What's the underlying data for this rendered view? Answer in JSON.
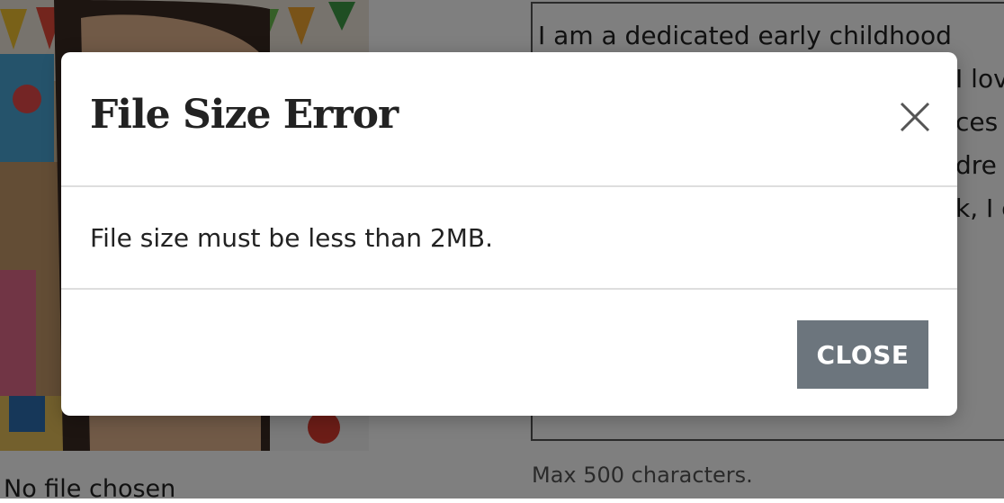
{
  "background": {
    "file_status": "No file chosen",
    "bio_lines": [
      "I am a dedicated early childhood",
      "I lov",
      "ces",
      "dre",
      "k, I e"
    ],
    "max_note": "Max 500 characters."
  },
  "modal": {
    "title": "File Size Error",
    "message": "File size must be less than 2MB.",
    "close_button_label": "CLOSE",
    "close_icon": "close-x-icon"
  },
  "colors": {
    "button_bg": "#6c757d",
    "overlay": "rgba(0,0,0,0.5)"
  }
}
